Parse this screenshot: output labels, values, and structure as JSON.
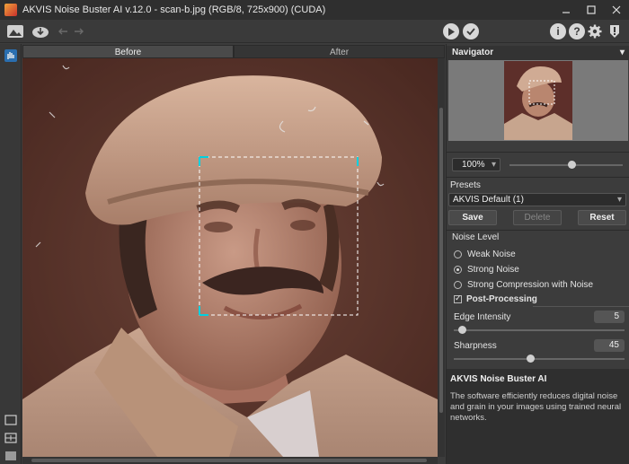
{
  "window": {
    "title": "AKVIS Noise Buster AI v.12.0 - scan-b.jpg (RGB/8, 725x900) (CUDA)",
    "minimize_icon": "minimize-icon",
    "maximize_icon": "maximize-icon",
    "close_icon": "close-icon"
  },
  "toolbar": {
    "left_icons": [
      "open-image-icon",
      "save-download-icon",
      "undo-arrow-icon",
      "redo-arrow-icon"
    ],
    "right_icons": [
      "run-play-icon",
      "apply-check-icon",
      "info-icon",
      "help-icon",
      "settings-gear-icon",
      "notifications-icon"
    ]
  },
  "tools": {
    "top": "hand-pan-icon",
    "bottom": [
      "single-view-icon",
      "split-view-icon",
      "fill-view-icon"
    ]
  },
  "tabs": [
    {
      "label": "Before",
      "active": true
    },
    {
      "label": "After",
      "active": false
    }
  ],
  "navigator": {
    "title": "Navigator",
    "zoom": "100%",
    "zoom_slider_level": 0.55
  },
  "presets": {
    "title": "Presets",
    "selected": "AKVIS Default (1)",
    "save_label": "Save",
    "delete_label": "Delete",
    "reset_label": "Reset"
  },
  "noise_level": {
    "title": "Noise Level",
    "options": [
      {
        "label": "Weak Noise",
        "selected": false
      },
      {
        "label": "Strong Noise",
        "selected": true
      },
      {
        "label": "Strong Compression with Noise",
        "selected": false
      }
    ],
    "post_processing_label": "Post-Processing",
    "post_processing_checked": true,
    "edge_intensity_label": "Edge Intensity",
    "edge_intensity_value": "5",
    "edge_intensity_level": 0.05,
    "sharpness_label": "Sharpness",
    "sharpness_value": "45",
    "sharpness_level": 0.45
  },
  "help": {
    "title": "AKVIS Noise Buster AI",
    "body": "The software efficiently reduces digital noise and grain in your images using trained neural networks."
  },
  "colors": {
    "accent_selection": "#00d0e0",
    "background_dark": "#2f2f2f"
  }
}
